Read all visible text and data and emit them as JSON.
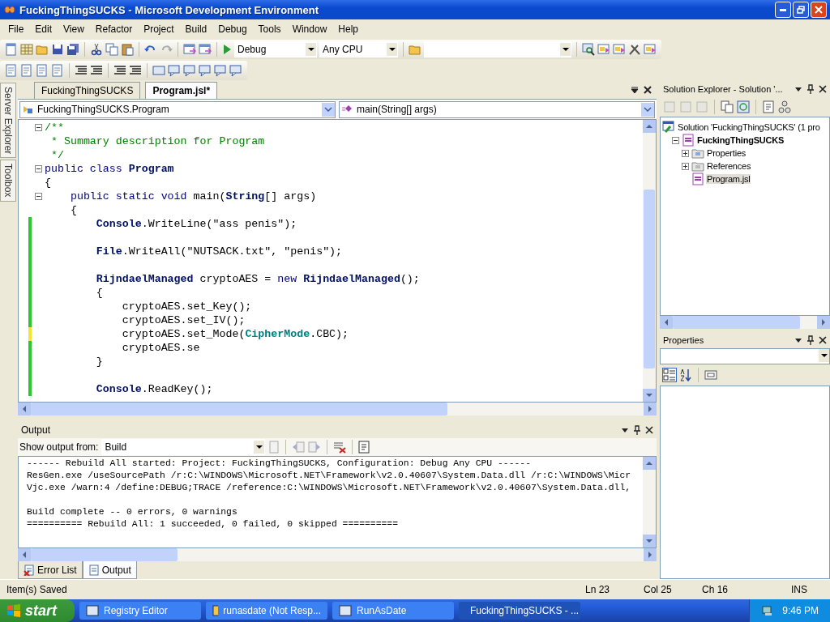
{
  "window": {
    "title": "FuckingThingSUCKS - Microsoft Development Environment"
  },
  "menu": [
    "File",
    "Edit",
    "View",
    "Refactor",
    "Project",
    "Build",
    "Debug",
    "Tools",
    "Window",
    "Help"
  ],
  "toolbar": {
    "configuration": "Debug",
    "platform": "Any CPU"
  },
  "side_tabs": [
    "Server Explorer",
    "Toolbox"
  ],
  "doc_tabs": [
    {
      "label": "FuckingThingSUCKS",
      "selected": false
    },
    {
      "label": "Program.jsl*",
      "selected": true
    }
  ],
  "nav": {
    "type": "FuckingThingSUCKS.Program",
    "member": "main(String[] args)"
  },
  "code": [
    {
      "fold": true,
      "tokens": [
        {
          "kind": "comment",
          "t": "/**"
        }
      ]
    },
    {
      "fold": false,
      "tokens": [
        {
          "kind": "comment",
          "t": " * Summary description for Program"
        }
      ]
    },
    {
      "fold": false,
      "tokens": [
        {
          "kind": "comment",
          "t": " */"
        }
      ]
    },
    {
      "fold": true,
      "tokens": [
        {
          "kind": "keyword",
          "t": "public class "
        },
        {
          "kind": "type",
          "t": "Program"
        }
      ]
    },
    {
      "fold": false,
      "tokens": [
        {
          "kind": "plain",
          "t": "{"
        }
      ]
    },
    {
      "fold": true,
      "tokens": [
        {
          "kind": "keyword",
          "t": "    public static void "
        },
        {
          "kind": "plain",
          "t": "main("
        },
        {
          "kind": "type",
          "t": "String"
        },
        {
          "kind": "plain",
          "t": "[] args)"
        }
      ]
    },
    {
      "fold": false,
      "tokens": [
        {
          "kind": "plain",
          "t": "    {"
        }
      ]
    },
    {
      "fold": false,
      "color": "#2ec82e",
      "tokens": [
        {
          "kind": "type",
          "t": "        Console"
        },
        {
          "kind": "plain",
          "t": ".WriteLine(\"ass penis\");"
        }
      ]
    },
    {
      "fold": false,
      "color": "#2ec82e"
    },
    {
      "fold": false,
      "color": "#2ec82e",
      "tokens": [
        {
          "kind": "type",
          "t": "        File"
        },
        {
          "kind": "plain",
          "t": ".WriteAll(\"NUTSACK.txt\", \"penis\");"
        }
      ]
    },
    {
      "fold": false,
      "color": "#2ec82e"
    },
    {
      "fold": false,
      "color": "#2ec82e",
      "tokens": [
        {
          "kind": "type",
          "t": "        RijndaelManaged"
        },
        {
          "kind": "plain",
          "t": " cryptoAES = "
        },
        {
          "kind": "keyword",
          "t": "new "
        },
        {
          "kind": "type",
          "t": "RijndaelManaged"
        },
        {
          "kind": "plain",
          "t": "();"
        }
      ]
    },
    {
      "fold": false,
      "color": "#2ec82e",
      "tokens": [
        {
          "kind": "plain",
          "t": "        {"
        }
      ]
    },
    {
      "fold": false,
      "color": "#2ec82e",
      "tokens": [
        {
          "kind": "plain",
          "t": "            cryptoAES.set_Key();"
        }
      ]
    },
    {
      "fold": false,
      "color": "#2ec82e",
      "tokens": [
        {
          "kind": "plain",
          "t": "            cryptoAES.set_IV();"
        }
      ]
    },
    {
      "fold": false,
      "color": "#f0e830",
      "tokens": [
        {
          "kind": "plain",
          "t": "            cryptoAES.set_Mode("
        },
        {
          "kind": "enum",
          "t": "CipherMode"
        },
        {
          "kind": "plain",
          "t": ".CBC);"
        }
      ]
    },
    {
      "fold": false,
      "color": "#2ec82e",
      "tokens": [
        {
          "kind": "plain",
          "t": "            cryptoAES.se"
        }
      ]
    },
    {
      "fold": false,
      "color": "#2ec82e",
      "tokens": [
        {
          "kind": "plain",
          "t": "        }"
        }
      ]
    },
    {
      "fold": false,
      "color": "#2ec82e"
    },
    {
      "fold": false,
      "color": "#2ec82e",
      "tokens": [
        {
          "kind": "type",
          "t": "        Console"
        },
        {
          "kind": "plain",
          "t": ".ReadKey();"
        }
      ]
    }
  ],
  "output": {
    "title": "Output",
    "source_label": "Show output from:",
    "source": "Build",
    "log": [
      "------ Rebuild All started: Project: FuckingThingSUCKS, Configuration: Debug Any CPU ------",
      "ResGen.exe /useSourcePath /r:C:\\WINDOWS\\Microsoft.NET\\Framework\\v2.0.40607\\System.Data.dll /r:C:\\WINDOWS\\Micr",
      "Vjc.exe /warn:4 /define:DEBUG;TRACE /reference:C:\\WINDOWS\\Microsoft.NET\\Framework\\v2.0.40607\\System.Data.dll,"
    ],
    "summary": [
      "Build complete -- 0 errors, 0 warnings",
      "========== Rebuild All: 1 succeeded, 0 failed, 0 skipped =========="
    ]
  },
  "bottom_tabs": [
    {
      "label": "Error List",
      "selected": false
    },
    {
      "label": "Output",
      "selected": true
    }
  ],
  "solution_explorer": {
    "title": "Solution Explorer - Solution '...",
    "tree": [
      {
        "label": "Solution 'FuckingThingSUCKS' (1 pro",
        "kind": "solution",
        "selected": false,
        "children": [
          {
            "label": "FuckingThingSUCKS",
            "kind": "project",
            "expanded": true,
            "selected": false,
            "children": [
              {
                "label": "Properties",
                "kind": "folder",
                "expanded": false,
                "selected": false
              },
              {
                "label": "References",
                "kind": "refs",
                "expanded": false,
                "selected": false
              },
              {
                "label": "Program.jsl",
                "kind": "file",
                "selected": true
              }
            ]
          }
        ]
      }
    ]
  },
  "properties": {
    "title": "Properties"
  },
  "status_bar": {
    "message": "Item(s) Saved",
    "line": "Ln 23",
    "col": "Col 25",
    "ch": "Ch 16",
    "mode": "INS"
  },
  "taskbar": {
    "start": "start",
    "items": [
      {
        "label": "Registry Editor",
        "selected": false
      },
      {
        "label": "runasdate (Not Resp...",
        "selected": false
      },
      {
        "label": "RunAsDate",
        "selected": false
      },
      {
        "label": "FuckingThingSUCKS - ...",
        "selected": true
      }
    ],
    "clock": "9:46 PM"
  }
}
